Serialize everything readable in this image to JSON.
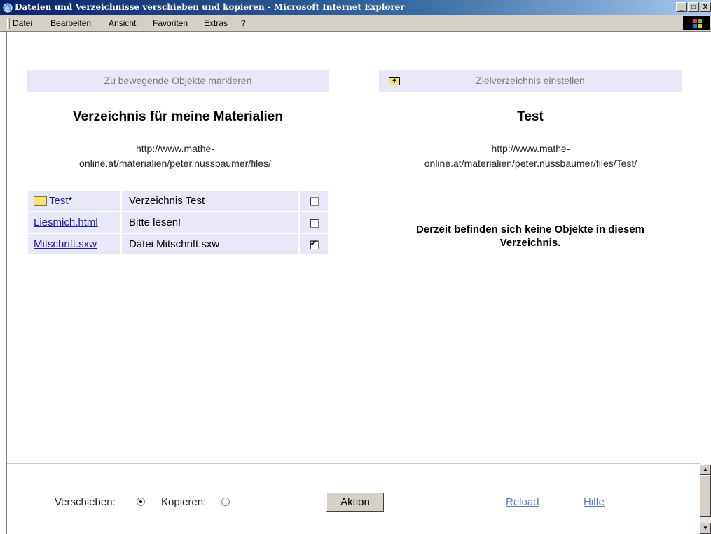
{
  "window": {
    "title": "Dateien und Verzeichnisse verschieben und kopieren - Microsoft Internet Explorer",
    "buttons": [
      "_",
      "□",
      "X"
    ]
  },
  "menu": [
    {
      "label": "Datei",
      "accel": "D",
      "rest": "atei"
    },
    {
      "label": "Bearbeiten",
      "accel": "B",
      "rest": "earbeiten"
    },
    {
      "label": "Ansicht",
      "accel": "A",
      "rest": "nsicht"
    },
    {
      "label": "Favoriten",
      "accel": "F",
      "rest": "avoriten"
    },
    {
      "label": "Extras",
      "pre": "E",
      "accel": "x",
      "rest": "tras"
    },
    {
      "label": "?",
      "accel": "?",
      "rest": ""
    }
  ],
  "left": {
    "header": "Zu bewegende Objekte markieren",
    "title": "Verzeichnis für meine Materialien",
    "url_line1": "http://www.mathe-",
    "url_line2": "online.at/materialien/peter.nussbaumer/files/",
    "rows": [
      {
        "name": "Test",
        "suffix": "*",
        "desc": "Verzeichnis Test",
        "checked": false,
        "folder": true
      },
      {
        "name": "Liesmich.html",
        "suffix": "",
        "desc": "Bitte lesen!",
        "checked": false,
        "folder": false
      },
      {
        "name": "Mitschrift.sxw",
        "suffix": "",
        "desc": "Datei Mitschrift.sxw",
        "checked": true,
        "folder": false
      }
    ]
  },
  "right": {
    "header": "Zielverzeichnis einstellen",
    "title": "Test",
    "url_line1": "http://www.mathe-",
    "url_line2": "online.at/materialien/peter.nussbaumer/files/Test/",
    "empty_line1": "Derzeit befinden sich keine Objekte in diesem",
    "empty_line2": "Verzeichnis."
  },
  "bottom": {
    "move_label": "Verschieben:",
    "copy_label": "Kopieren:",
    "mode": "move",
    "action_button": "Aktion",
    "reload_link": "Reload",
    "help_link": "Hilfe"
  }
}
